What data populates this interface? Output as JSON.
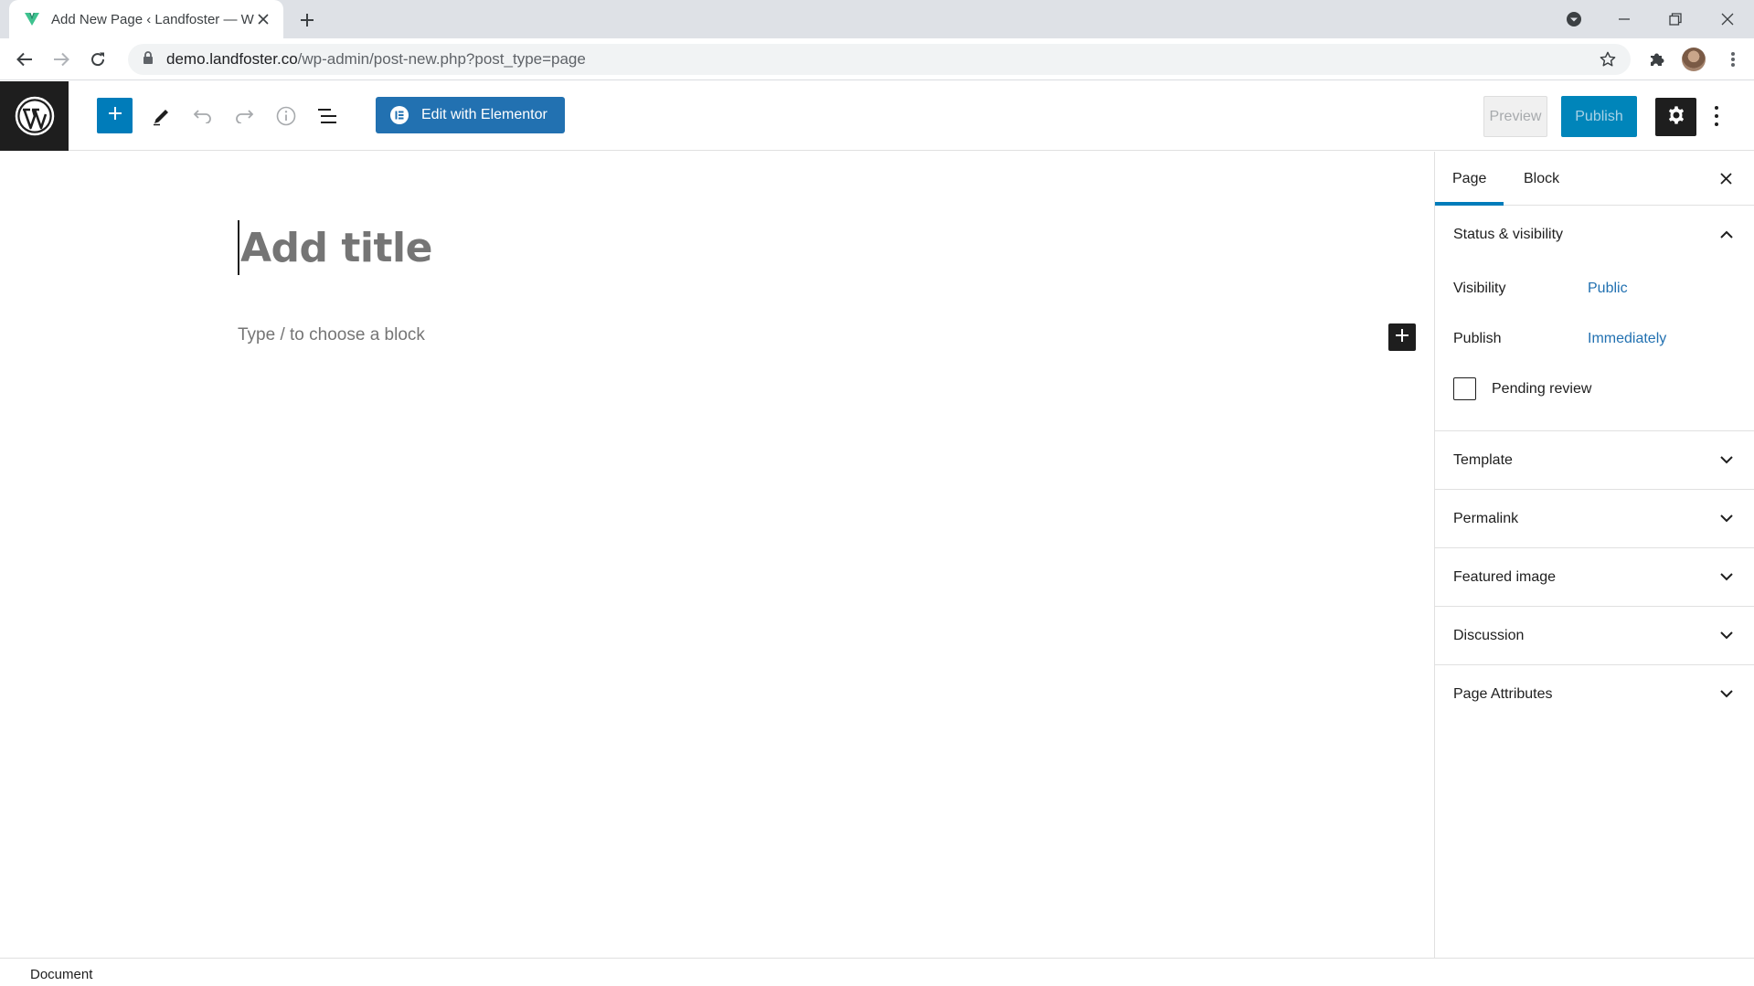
{
  "browser": {
    "tab_title": "Add New Page ‹ Landfoster — W",
    "url_domain": "demo.landfoster.co",
    "url_path": "/wp-admin/post-new.php?post_type=page"
  },
  "header": {
    "elementor_label": "Edit with Elementor",
    "preview_label": "Preview",
    "publish_label": "Publish"
  },
  "editor": {
    "title_placeholder": "Add title",
    "block_placeholder": "Type / to choose a block"
  },
  "sidebar": {
    "tabs": [
      {
        "label": "Page",
        "active": true
      },
      {
        "label": "Block",
        "active": false
      }
    ],
    "status_visibility": {
      "title": "Status & visibility",
      "visibility_label": "Visibility",
      "visibility_value": "Public",
      "publish_label": "Publish",
      "publish_value": "Immediately",
      "pending_review_label": "Pending review",
      "pending_review_checked": false
    },
    "panels": [
      {
        "title": "Template"
      },
      {
        "title": "Permalink"
      },
      {
        "title": "Featured image"
      },
      {
        "title": "Discussion"
      },
      {
        "title": "Page Attributes"
      }
    ]
  },
  "footer": {
    "breadcrumb": "Document"
  },
  "colors": {
    "wp_blue": "#007cba",
    "link_blue": "#2271b1",
    "publish_bg": "#0085ba",
    "dark": "#1e1e1e"
  }
}
